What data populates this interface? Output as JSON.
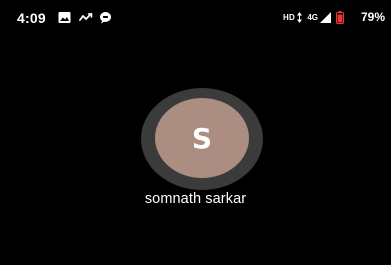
{
  "status_bar": {
    "time": "4:09",
    "notification_icons": [
      "image-icon",
      "trend-icon",
      "chat-bubble-icon"
    ],
    "hd_label": "HD",
    "network_label": "4G",
    "battery_percent": "79%",
    "battery_color": "#e53935"
  },
  "contact": {
    "initial": "S",
    "name": "somnath sarkar",
    "avatar_color": "#ab8d81",
    "ring_color": "#3b3b3b"
  }
}
